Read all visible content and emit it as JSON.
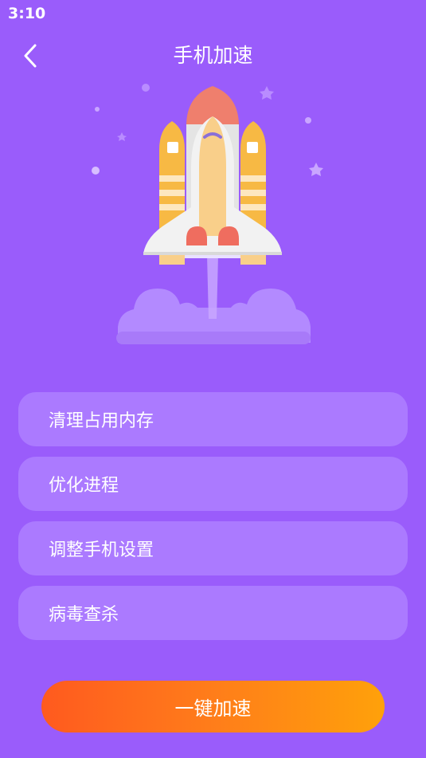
{
  "status_bar": {
    "time": "3:10"
  },
  "header": {
    "title": "手机加速",
    "back_icon": "chevron-left-icon"
  },
  "illustration": {
    "subject": "rocket-launch-icon"
  },
  "menu": {
    "items": [
      {
        "label": "清理占用内存"
      },
      {
        "label": "优化进程"
      },
      {
        "label": "调整手机设置"
      },
      {
        "label": "病毒查杀"
      }
    ]
  },
  "action": {
    "boost_label": "一键加速"
  },
  "colors": {
    "background": "#9a5cfb",
    "card": "#ab7aff",
    "button_start": "#ff5a1f",
    "button_end": "#ffa10a"
  }
}
